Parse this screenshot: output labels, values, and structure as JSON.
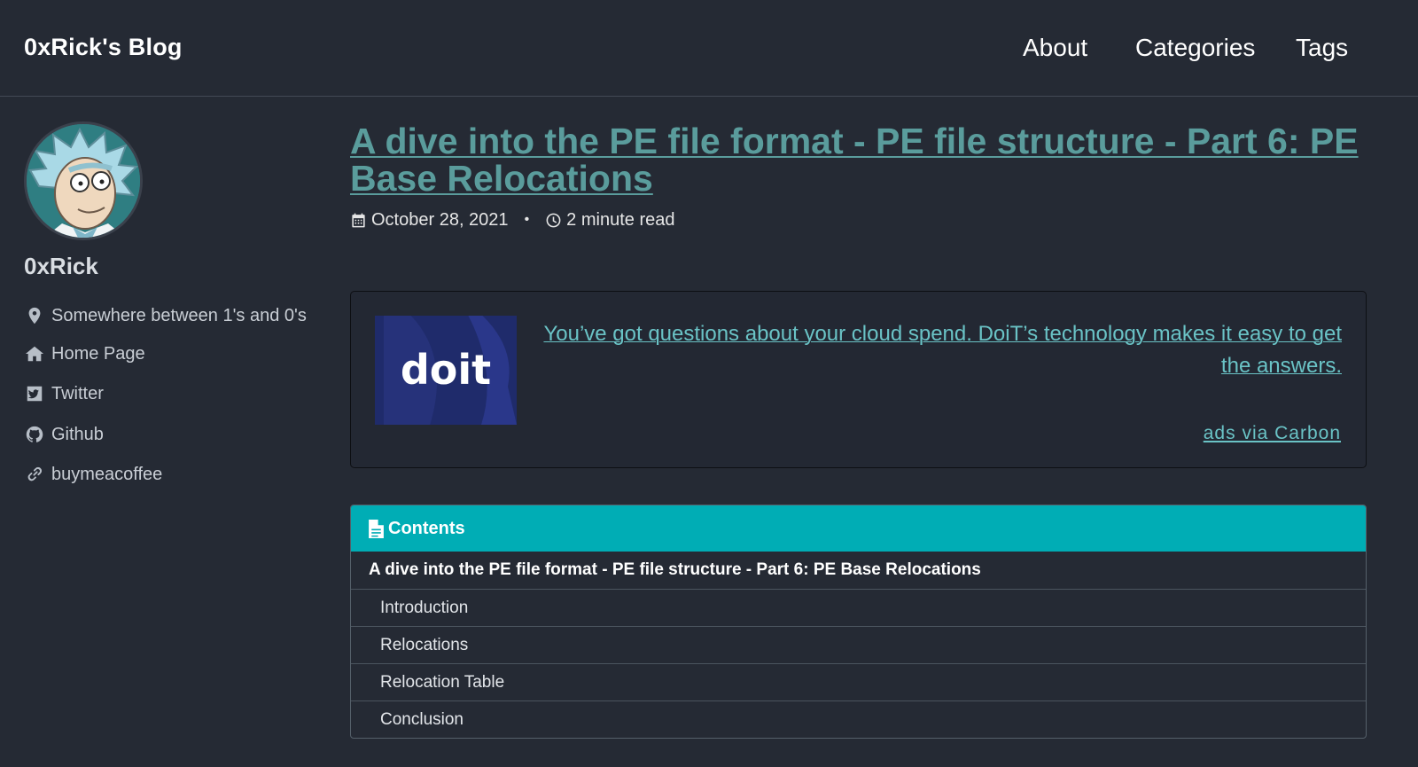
{
  "site": {
    "title": "0xRick's Blog"
  },
  "nav": {
    "items": [
      "About",
      "Categories",
      "Tags"
    ]
  },
  "author": {
    "name": "0xRick",
    "links": [
      {
        "icon": "map-marker-icon",
        "label": "Somewhere between 1's and 0's"
      },
      {
        "icon": "home-icon",
        "label": "Home Page"
      },
      {
        "icon": "twitter-icon",
        "label": "Twitter"
      },
      {
        "icon": "github-icon",
        "label": "Github"
      },
      {
        "icon": "link-icon",
        "label": "buymeacoffee"
      }
    ]
  },
  "post": {
    "title": "A dive into the PE file format - PE file structure - Part 6: PE Base Relocations",
    "date": "October 28, 2021",
    "separator": "•",
    "read_time": "2 minute read"
  },
  "ad": {
    "logo_text": "doit",
    "text": "You’ve got questions about your cloud spend. DoiT’s technology makes it easy to get the answers.",
    "via": "ads via Carbon"
  },
  "toc": {
    "header": "Contents",
    "main": "A dive into the PE file format - PE file structure - Part 6: PE Base Relocations",
    "items": [
      "Introduction",
      "Relocations",
      "Relocation Table",
      "Conclusion"
    ]
  },
  "colors": {
    "background": "#252a34",
    "title_link": "#5a9c9c",
    "ad_link": "#6ac3c6",
    "toc_header": "#00adb5"
  }
}
